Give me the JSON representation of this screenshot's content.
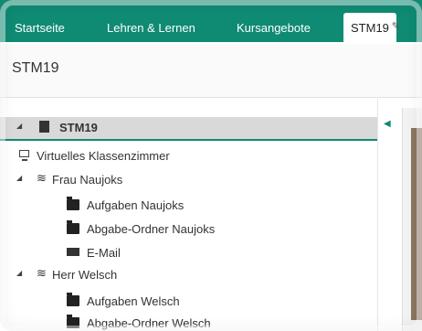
{
  "tabs": [
    {
      "label": "Startseite"
    },
    {
      "label": "Lehren & Lernen"
    },
    {
      "label": "Kursangebote"
    },
    {
      "label": "STM19"
    }
  ],
  "page": {
    "title": "STM19"
  },
  "tree": [
    {
      "label": "STM19",
      "icon": "book-icon",
      "level": 0,
      "expanded": true,
      "selected": true
    },
    {
      "label": "Virtuelles Klassenzimmer",
      "icon": "monitor-icon",
      "level": 1
    },
    {
      "label": "Frau Naujoks",
      "icon": "stack-icon",
      "level": 1,
      "expanded": true
    },
    {
      "label": "Aufgaben Naujoks",
      "icon": "folder-icon",
      "level": 2
    },
    {
      "label": "Abgabe-Ordner Naujoks",
      "icon": "folder-icon",
      "level": 2
    },
    {
      "label": "E-Mail",
      "icon": "mail-icon",
      "level": 2
    },
    {
      "label": "Herr Welsch",
      "icon": "stack-icon",
      "level": 1,
      "expanded": true
    },
    {
      "label": "Aufgaben Welsch",
      "icon": "folder-icon",
      "level": 2
    },
    {
      "label": "Abgabe-Ordner Welsch",
      "icon": "folder-icon",
      "level": 2
    }
  ],
  "colors": {
    "accent": "#0f8a73"
  }
}
